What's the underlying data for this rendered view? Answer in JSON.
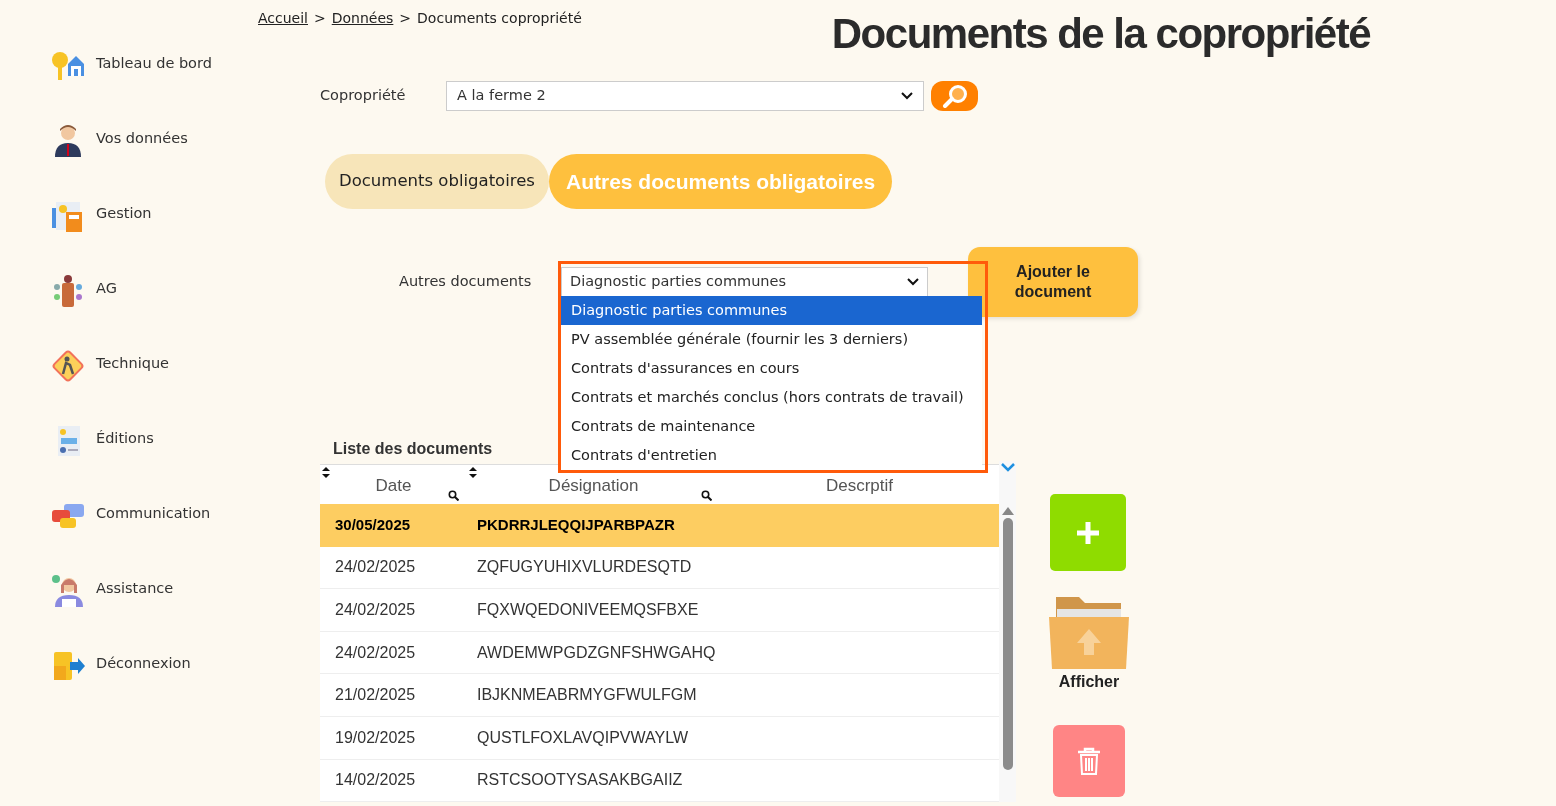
{
  "sidebar": {
    "items": [
      {
        "label": "Tableau de bord"
      },
      {
        "label": "Vos données"
      },
      {
        "label": "Gestion"
      },
      {
        "label": "AG"
      },
      {
        "label": "Technique"
      },
      {
        "label": "Éditions"
      },
      {
        "label": "Communication"
      },
      {
        "label": "Assistance"
      },
      {
        "label": "Déconnexion"
      }
    ]
  },
  "breadcrumb": [
    {
      "label": "Accueil",
      "link": true
    },
    {
      "label": ">",
      "link": false
    },
    {
      "label": "Données",
      "link": true
    },
    {
      "label": ">",
      "link": false
    },
    {
      "label": "Documents copropriété",
      "link": false
    }
  ],
  "title": "Documents de la copropriété",
  "copropriete": {
    "label": "Copropriété",
    "value": "A la ferme 2"
  },
  "tabs": [
    {
      "label": "Documents obligatoires",
      "selected": false
    },
    {
      "label": "Autres documents obligatoires",
      "selected": true
    }
  ],
  "autres_documents": {
    "label": "Autres documents",
    "value": "Diagnostic parties communes",
    "expanded": true,
    "options": [
      {
        "label": "Diagnostic parties communes",
        "selected": true
      },
      {
        "label": "PV assemblée générale (fournir les 3 derniers)",
        "selected": false
      },
      {
        "label": "Contrats d'assurances en cours",
        "selected": false
      },
      {
        "label": "Contrats et marchés conclus (hors contrats de travail)",
        "selected": false
      },
      {
        "label": "Contrats de maintenance",
        "selected": false
      },
      {
        "label": "Contrats d'entretien",
        "selected": false
      }
    ]
  },
  "add_button": "Ajouter le document",
  "list_title": "Liste des documents",
  "table": {
    "columns": [
      {
        "label": "Date",
        "sortable": true,
        "searchable": true
      },
      {
        "label": "Désignation",
        "sortable": true,
        "searchable": true
      },
      {
        "label": "Descrptif",
        "sortable": false,
        "searchable": false
      }
    ],
    "rows": [
      {
        "date": "30/05/2025",
        "designation": "PKDRRJLEQQIJPARBPAZR",
        "selected": true
      },
      {
        "date": "24/02/2025",
        "designation": "ZQFUGYUHIXVLURDESQTD",
        "selected": false
      },
      {
        "date": "24/02/2025",
        "designation": "FQXWQEDONIVEEMQSFBXE",
        "selected": false
      },
      {
        "date": "24/02/2025",
        "designation": "AWDEMWPGDZGNFSHWGAHQ",
        "selected": false
      },
      {
        "date": "21/02/2025",
        "designation": "IBJKNMEABRMYGFWULFGM",
        "selected": false
      },
      {
        "date": "19/02/2025",
        "designation": "QUSTLFOXLAVQIPVWAYLW",
        "selected": false
      },
      {
        "date": "14/02/2025",
        "designation": "RSTCSOOTYSASAKBGAIIZ",
        "selected": false
      }
    ]
  },
  "actions": [
    {
      "kind": "add"
    },
    {
      "kind": "show",
      "label": "Afficher"
    },
    {
      "kind": "delete"
    }
  ]
}
